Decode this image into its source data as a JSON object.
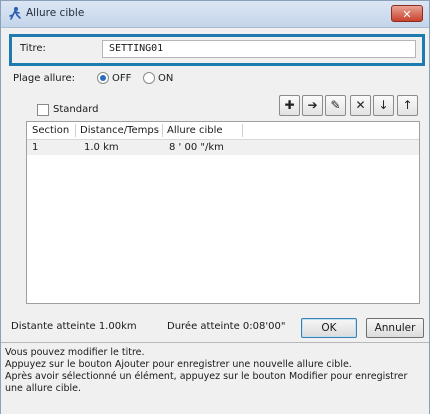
{
  "window": {
    "title": "Allure cible",
    "close_glyph": "✕"
  },
  "title_field": {
    "label": "Titre:",
    "value": "SETTING01"
  },
  "plage": {
    "label": "Plage allure:",
    "options": [
      {
        "label": "OFF",
        "selected": true
      },
      {
        "label": "ON",
        "selected": false
      }
    ]
  },
  "standard": {
    "label": "Standard",
    "checked": false
  },
  "toolbar": {
    "buttons": [
      {
        "name": "add",
        "glyph": "✚",
        "icon": "add-icon"
      },
      {
        "name": "insert",
        "glyph": "➔",
        "icon": "arrow-right-icon"
      },
      {
        "name": "edit",
        "glyph": "✎",
        "icon": "pencil-icon"
      },
      {
        "name": "delete",
        "glyph": "✕",
        "icon": "delete-icon"
      },
      {
        "name": "move-down",
        "glyph": "↓",
        "icon": "arrow-down-icon"
      },
      {
        "name": "move-up",
        "glyph": "↑",
        "icon": "arrow-up-icon"
      }
    ]
  },
  "table": {
    "headers": [
      "Section",
      "Distance/Temps",
      "Allure cible"
    ],
    "rows": [
      [
        "1",
        "1.0 km",
        "8  ' 00 \"/km"
      ]
    ]
  },
  "footer": {
    "distance_text": "Distante atteinte  1.00km",
    "duree_text": "Durée atteinte  0:08'00\"",
    "ok_label": "OK",
    "cancel_label": "Annuler"
  },
  "help": {
    "lines": [
      "Vous pouvez modifier le titre.",
      "Appuyez sur le bouton Ajouter pour enregistrer une nouvelle allure cible.",
      "Après avoir sélectionné un élément, appuyez sur le bouton Modifier pour enregistrer",
      "une allure cible."
    ]
  },
  "colors": {
    "accent": "#1e7bb0",
    "close": "#c9412b"
  }
}
